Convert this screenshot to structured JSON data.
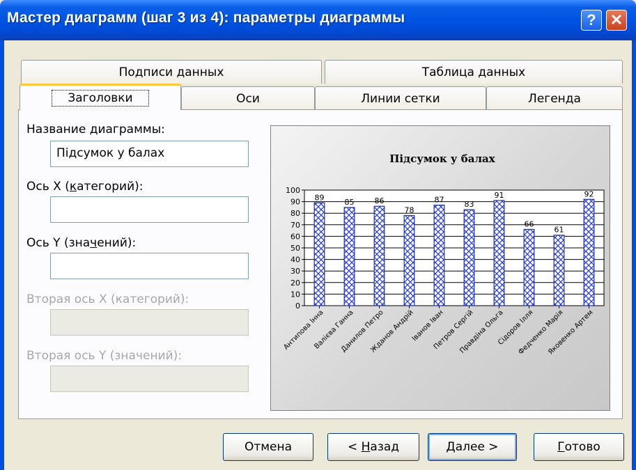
{
  "window": {
    "title": "Мастер диаграмм (шаг 3 из 4): параметры диаграммы",
    "help_glyph": "?",
    "close_glyph": "✕"
  },
  "tabs": {
    "row1": [
      "Подписи данных",
      "Таблица данных"
    ],
    "row2": [
      "Заголовки",
      "Оси",
      "Линии сетки",
      "Легенда"
    ],
    "active": "Заголовки"
  },
  "form": {
    "chart_title_label_pre": "Название диаграммы:",
    "chart_title_value": "Підсумок у балах",
    "x_axis_label_pre": "Ось X (",
    "x_axis_label_u": "к",
    "x_axis_label_post": "атегорий):",
    "x_axis_value": "",
    "y_axis_label_pre": "Ось Y (зна",
    "y_axis_label_u": "ч",
    "y_axis_label_post": "ений):",
    "y_axis_value": "",
    "x2_axis_label": "Вторая ось X (категорий):",
    "y2_axis_label": "Вторая ось Y (значений):"
  },
  "buttons": {
    "cancel": "Отмена",
    "back_pre": "< ",
    "back_u": "Н",
    "back_post": "азад",
    "next_u": "Д",
    "next_post": "алее >",
    "finish_u": "Г",
    "finish_post": "отово"
  },
  "chart_data": {
    "type": "bar",
    "title": "Підсумок у балах",
    "categories": [
      "Антипова Інна",
      "Валієва Ганна",
      "Данилов Петро",
      "Жданов Андрій",
      "Іванов Іван",
      "Петров Сергій",
      "Правдіна Ольга",
      "Сідоров Ілля",
      "Федченко Марія",
      "Яковенко Артем"
    ],
    "values": [
      89,
      85,
      86,
      78,
      87,
      83,
      91,
      66,
      61,
      92
    ],
    "ylim": [
      0,
      100
    ],
    "yticks": [
      0,
      10,
      20,
      30,
      40,
      50,
      60,
      70,
      80,
      90,
      100
    ],
    "grid": true,
    "data_labels": true,
    "fill": "crosshatch-blue"
  }
}
